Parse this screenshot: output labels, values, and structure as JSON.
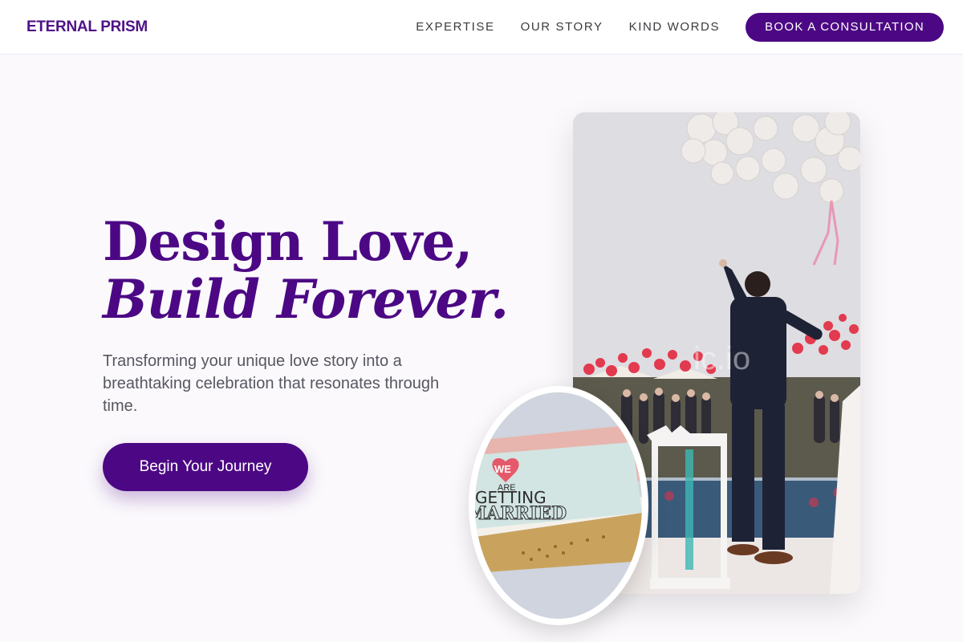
{
  "brand": {
    "name": "ETERNAL PRISM",
    "accent": "#4c0884"
  },
  "nav": {
    "links": [
      "EXPERTISE",
      "OUR STORY",
      "KIND WORDS"
    ],
    "cta_label": "BOOK A CONSULTATION"
  },
  "hero": {
    "title_line1": "Design Love,",
    "title_line2": "Build Forever.",
    "subtitle": "Transforming your unique love story into a breathtaking celebration that resonates through time.",
    "cta_label": "Begin Your Journey"
  },
  "images": {
    "main_photo": "wedding-balloons-photo",
    "invitation_photo": "wedding-invitation-photo",
    "invitation_text": [
      "WE",
      "ARE",
      "GETTING",
      "MARRIED"
    ],
    "watermark": "ic.io"
  }
}
